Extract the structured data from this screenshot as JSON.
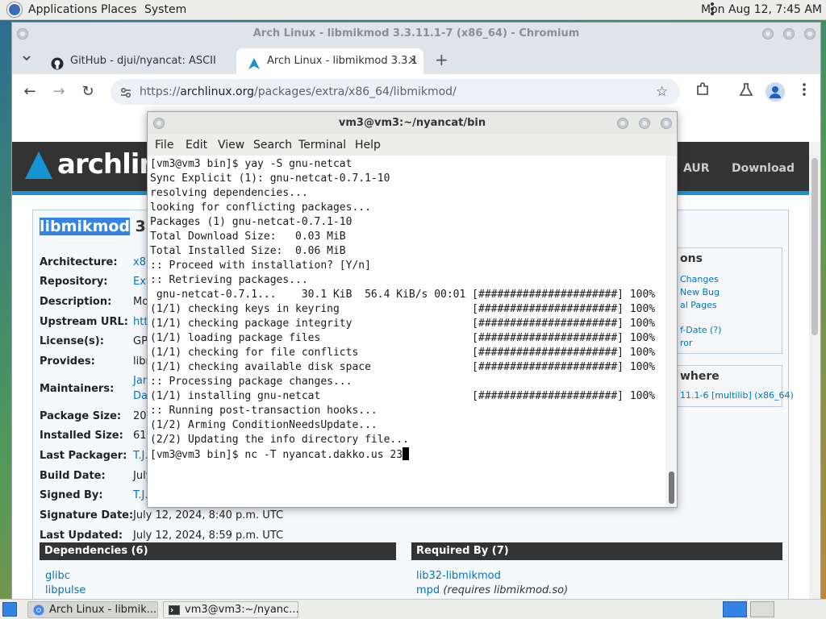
{
  "top_panel": {
    "menus": [
      "Applications",
      "Places",
      "System"
    ],
    "clock": "Mon Aug 12,  7:45 AM"
  },
  "browser": {
    "title": "Arch Linux - libmikmod 3.3.11.1-7 (x86_64) - Chromium",
    "tabs": [
      {
        "label": "GitHub - djui/nyancat: ASCII",
        "icon": "github-icon"
      },
      {
        "label": "Arch Linux - libmikmod 3.3.1",
        "icon": "arch-icon"
      }
    ],
    "new_tab": "+",
    "url": {
      "scheme": "https://",
      "host": "archlinux.org",
      "path": "/packages/extra/x86_64/libmikmod/"
    }
  },
  "arch_page": {
    "logo": "archlinux",
    "nav": [
      "AUR",
      "Download"
    ],
    "package_name": "libmikmod",
    "package_version": "3.3.",
    "fields": [
      {
        "label": "Architecture:",
        "value": "x86",
        "link": true
      },
      {
        "label": "Repository:",
        "value": "Ext",
        "link": true
      },
      {
        "label": "Description:",
        "value": "Mo",
        "link": false
      },
      {
        "label": "Upstream URL:",
        "value": "http",
        "link": true
      },
      {
        "label": "License(s):",
        "value": "GP",
        "link": false
      },
      {
        "label": "Provides:",
        "value": "libn",
        "link": false
      },
      {
        "label": "Maintainers:",
        "value": "Jan",
        "value2": "Dav",
        "link": true
      },
      {
        "label": "Package Size:",
        "value": "208",
        "link": false
      },
      {
        "label": "Installed Size:",
        "value": "618",
        "link": false
      },
      {
        "label": "Last Packager:",
        "value": "T.J.",
        "link": true
      },
      {
        "label": "Build Date:",
        "value": "July",
        "link": false
      },
      {
        "label": "Signed By:",
        "value": "T.J.",
        "link": true
      },
      {
        "label": "Signature Date:",
        "value": "July 12, 2024, 8:40 p.m. UTC",
        "link": false
      },
      {
        "label": "Last Updated:",
        "value": "July 12, 2024, 8:59 p.m. UTC",
        "link": false
      }
    ],
    "actions_box": {
      "heading": "ons",
      "links": [
        "Changes",
        "New Bug",
        "al Pages",
        "f-Date (?)",
        "ror"
      ]
    },
    "elsewhere_box": {
      "heading": "where",
      "links": [
        "11.1-6 [multilib] (x86_64)"
      ]
    },
    "dependencies": {
      "heading": "Dependencies (6)",
      "items": [
        "glibc",
        "libpulse"
      ]
    },
    "required_by": {
      "heading": "Required By (7)",
      "items": [
        {
          "name": "lib32-libmikmod",
          "note": ""
        },
        {
          "name": "mpd",
          "note": "(requires libmikmod.so)"
        }
      ]
    }
  },
  "terminal": {
    "title": "vm3@vm3:~/nyancat/bin",
    "menu": [
      "File",
      "Edit",
      "View",
      "Search",
      "Terminal",
      "Help"
    ],
    "lines": [
      "[vm3@vm3 bin]$ yay -S gnu-netcat",
      "Sync Explicit (1): gnu-netcat-0.7.1-10",
      "resolving dependencies...",
      "looking for conflicting packages...",
      "",
      "Packages (1) gnu-netcat-0.7.1-10",
      "",
      "Total Download Size:   0.03 MiB",
      "Total Installed Size:  0.06 MiB",
      "",
      ":: Proceed with installation? [Y/n]",
      ":: Retrieving packages...",
      " gnu-netcat-0.7.1...    30.1 KiB  56.4 KiB/s 00:01 [######################] 100%",
      "(1/1) checking keys in keyring                     [######################] 100%",
      "(1/1) checking package integrity                   [######################] 100%",
      "(1/1) loading package files                        [######################] 100%",
      "(1/1) checking for file conflicts                  [######################] 100%",
      "(1/1) checking available disk space                [######################] 100%",
      ":: Processing package changes...",
      "(1/1) installing gnu-netcat                        [######################] 100%",
      ":: Running post-transaction hooks...",
      "(1/2) Arming ConditionNeedsUpdate...",
      "(2/2) Updating the info directory file...",
      "[vm3@vm3 bin]$ nc -T nyancat.dakko.us 23"
    ]
  },
  "taskbar": {
    "tasks": [
      {
        "label": "Arch Linux - libmik...",
        "icon": "chromium-icon"
      },
      {
        "label": "vm3@vm3:~/nyanc...",
        "icon": "terminal-icon"
      }
    ]
  },
  "colors": {
    "arch_blue": "#1793d1",
    "link": "#0077bb",
    "selection": "#3584e4"
  }
}
